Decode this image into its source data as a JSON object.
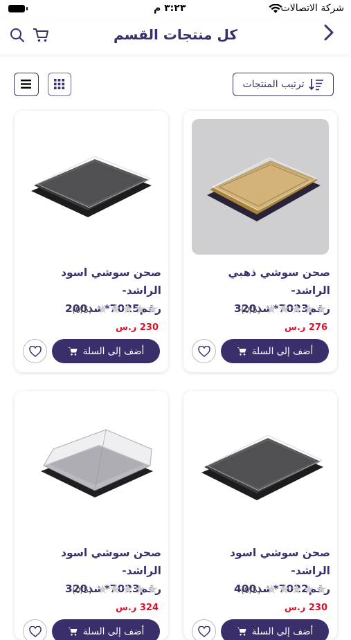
{
  "status_bar": {
    "carrier": "شركة الاتصالات",
    "time": "٣:٢٣ م"
  },
  "nav": {
    "title": "كل منتجات القسم",
    "icons": [
      "search-icon",
      "cart-icon",
      "back-chevron-icon"
    ]
  },
  "toolbar": {
    "sort_label": "ترتيب المنتجات",
    "icons": [
      "list-view-icon",
      "grid-view-icon",
      "sort-icon"
    ]
  },
  "colors": {
    "primary": "#3a2f6b",
    "price": "#d8102a",
    "star_empty": "#cfcfcf"
  },
  "products": [
    {
      "title": "صحن سوشي ذهبي الراشد-\nرقم7023*شد320",
      "rating_text": "(0/5)",
      "stars": 0,
      "price": "276 ر.س",
      "add_label": "أضف إلى السلة"
    },
    {
      "title": "صحن سوشي اسود الراشد-\nرقم7025*شد200",
      "rating_text": "(0/5)",
      "stars": 0,
      "price": "230 ر.س",
      "add_label": "أضف إلى السلة"
    },
    {
      "title": "صحن سوشي اسود الراشد-\nرقم7022*شد400",
      "rating_text": "(0/5)",
      "stars": 0,
      "price": "230 ر.س",
      "add_label": "أضف إلى السلة"
    },
    {
      "title": "صحن سوشي اسود الراشد-\nرقم7023*شد320",
      "rating_text": "(0/5)",
      "stars": 0,
      "price": "324 ر.س",
      "add_label": "أضف إلى السلة"
    }
  ]
}
